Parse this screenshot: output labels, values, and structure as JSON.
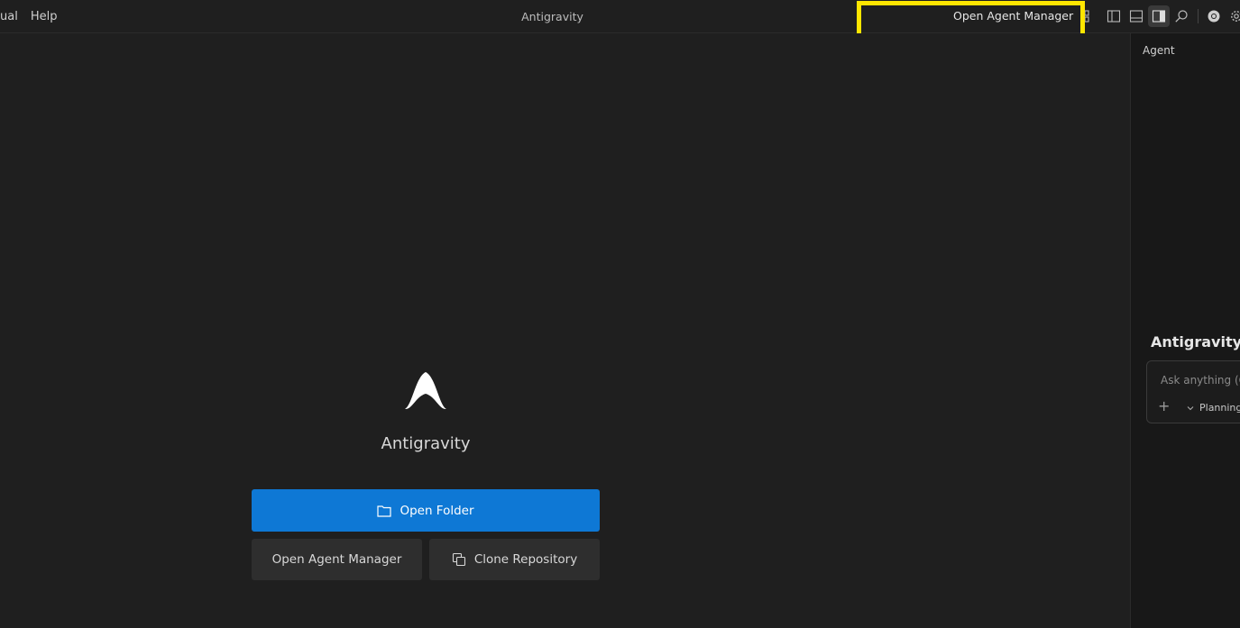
{
  "menu": {
    "items": [
      "ual",
      "Help"
    ]
  },
  "window": {
    "title": "Antigravity"
  },
  "titlebar": {
    "agent_manager_label": "Open Agent Manager",
    "icons": [
      "layout-grid-icon",
      "toggle-primary-sidebar-icon",
      "toggle-panel-icon",
      "toggle-secondary-sidebar-icon",
      "search-icon",
      "chrome-icon",
      "settings-gear-icon"
    ]
  },
  "welcome": {
    "brand": "Antigravity",
    "open_folder": "Open Folder",
    "open_agent_manager": "Open Agent Manager",
    "clone_repository": "Clone Repository"
  },
  "agent_panel": {
    "tab": "Agent",
    "title": "Antigravity",
    "input_placeholder": "Ask anything (Ct",
    "mode": "Planning"
  },
  "colors": {
    "accent": "#0e78d5",
    "highlight": "#ffe600",
    "background": "#1f1f1f"
  }
}
